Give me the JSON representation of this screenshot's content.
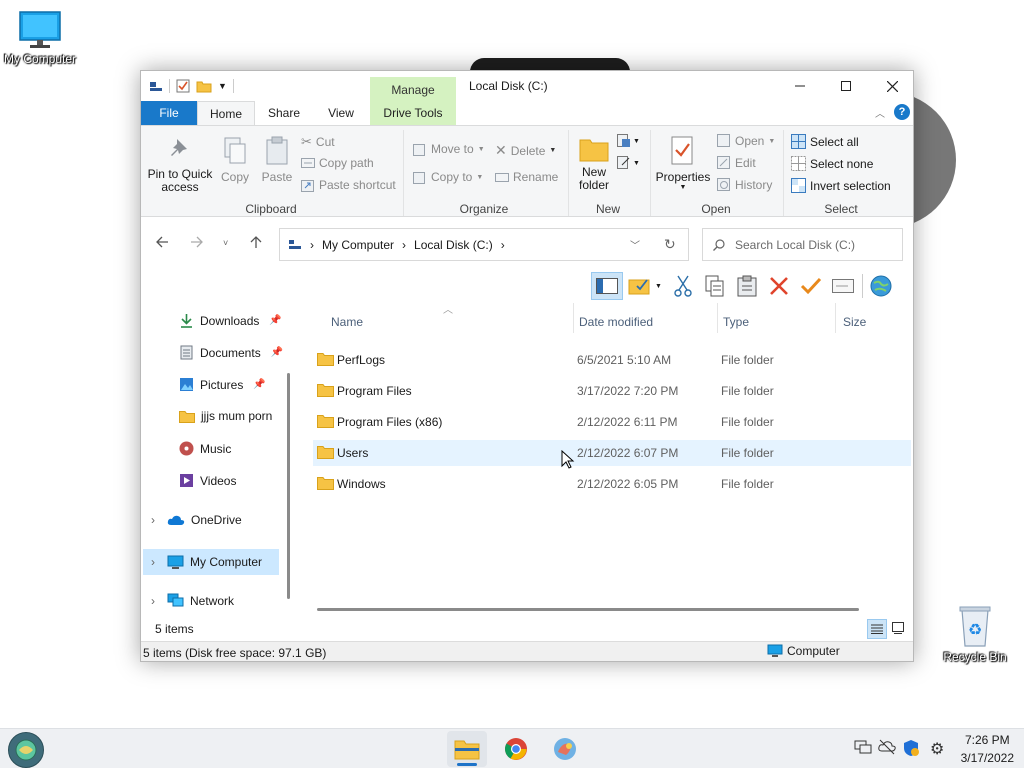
{
  "desktop": {
    "my_computer_label": "My Computer",
    "recycle_bin_label": "Recycle Bin"
  },
  "window": {
    "title": "Local Disk (C:)",
    "manage_tab": "Manage",
    "tabs": {
      "file": "File",
      "home": "Home",
      "share": "Share",
      "view": "View",
      "drive_tools": "Drive Tools"
    }
  },
  "ribbon": {
    "clipboard": {
      "pin": "Pin to Quick access",
      "copy": "Copy",
      "paste": "Paste",
      "cut": "Cut",
      "copy_path": "Copy path",
      "paste_shortcut": "Paste shortcut",
      "label": "Clipboard"
    },
    "organize": {
      "move_to": "Move to",
      "copy_to": "Copy to",
      "delete": "Delete",
      "rename": "Rename",
      "label": "Organize"
    },
    "new": {
      "new_folder_line1": "New",
      "new_folder_line2": "folder",
      "label": "New"
    },
    "open": {
      "properties": "Properties",
      "open": "Open",
      "edit": "Edit",
      "history": "History",
      "label": "Open"
    },
    "select": {
      "select_all": "Select all",
      "select_none": "Select none",
      "invert": "Invert selection",
      "label": "Select"
    }
  },
  "address": {
    "crumbs": [
      "My Computer",
      "Local Disk (C:)"
    ],
    "search_placeholder": "Search Local Disk (C:)"
  },
  "nav": {
    "items": [
      {
        "label": "Downloads",
        "pinned": true
      },
      {
        "label": "Documents",
        "pinned": true
      },
      {
        "label": "Pictures",
        "pinned": true
      },
      {
        "label": "jjjs mum porn",
        "pinned": false
      },
      {
        "label": "Music",
        "pinned": false
      },
      {
        "label": "Videos",
        "pinned": false
      },
      {
        "label": "OneDrive",
        "pinned": false
      },
      {
        "label": "My Computer",
        "pinned": false
      },
      {
        "label": "Network",
        "pinned": false
      }
    ]
  },
  "list": {
    "columns": {
      "name": "Name",
      "date": "Date modified",
      "type": "Type",
      "size": "Size"
    },
    "rows": [
      {
        "name": "PerfLogs",
        "date": "6/5/2021 5:10 AM",
        "type": "File folder"
      },
      {
        "name": "Program Files",
        "date": "3/17/2022 7:20 PM",
        "type": "File folder"
      },
      {
        "name": "Program Files (x86)",
        "date": "2/12/2022 6:11 PM",
        "type": "File folder"
      },
      {
        "name": "Users",
        "date": "2/12/2022 6:07 PM",
        "type": "File folder"
      },
      {
        "name": "Windows",
        "date": "2/12/2022 6:05 PM",
        "type": "File folder"
      }
    ]
  },
  "items_count": "5 items",
  "status": {
    "left": "5 items (Disk free space: 97.1 GB)",
    "right": "Computer"
  },
  "clock": {
    "time": "7:26 PM",
    "date": "3/17/2022"
  },
  "colors": {
    "accent": "#1979ca",
    "selected_row": "#e5f3ff",
    "manage_green": "#d5f2c1"
  }
}
